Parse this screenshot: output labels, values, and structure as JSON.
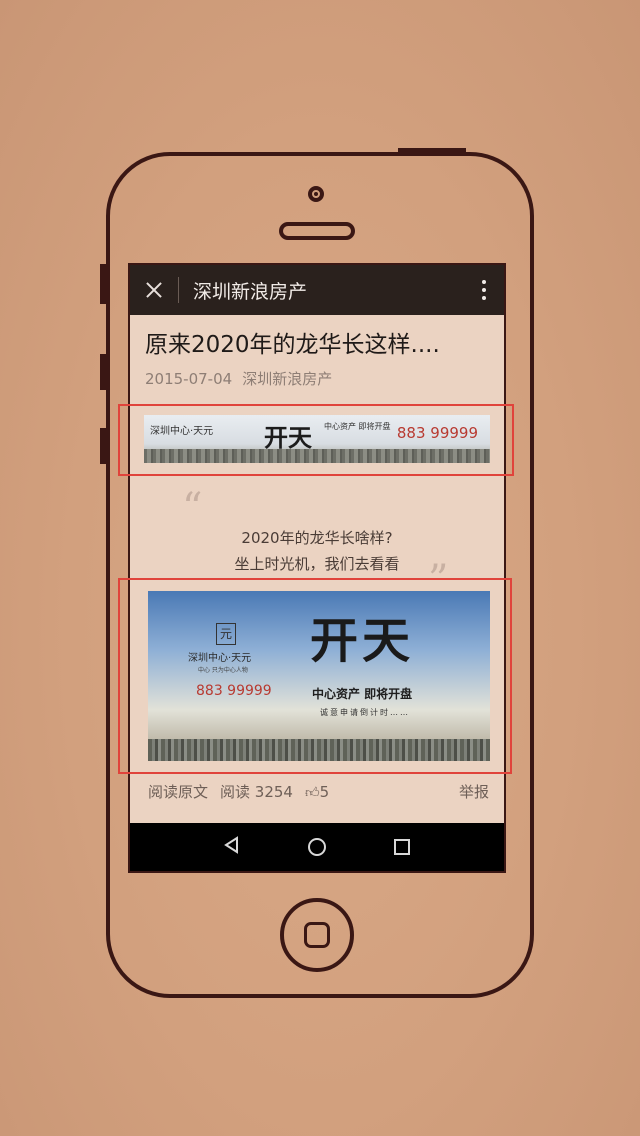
{
  "topbar": {
    "title": "深圳新浪房产"
  },
  "article": {
    "title": "原来2020年的龙华长这样....",
    "date": "2015-07-04",
    "author": "深圳新浪房产",
    "quote_line1": "2020年的龙华长啥样?",
    "quote_line2": "坐上时光机，我们去看看"
  },
  "banner1": {
    "brand": "深圳中心·天元",
    "headline": "开天",
    "slogan": "中心资产 即将开盘",
    "phone": "883 99999"
  },
  "banner2": {
    "logo": "元",
    "brand": "深圳中心·天元",
    "tagline": "中心 只为中心人物",
    "phone": "883 99999",
    "headline": "开天",
    "slogan": "中心资产  即将开盘",
    "sub": "诚意申请倒计时……"
  },
  "footer": {
    "read_original": "阅读原文",
    "read_count": "阅读 3254",
    "likes": "5",
    "report": "举报"
  },
  "colors": {
    "background": "#d2a07e",
    "phone_outline": "#3a1714",
    "highlight_frame": "#e0433b",
    "phone_number": "#b83a31"
  }
}
